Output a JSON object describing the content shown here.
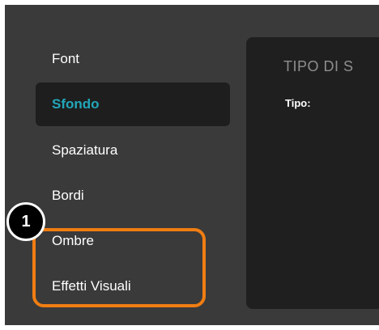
{
  "sidebar": {
    "items": [
      {
        "label": "Font"
      },
      {
        "label": "Sfondo",
        "active": true
      },
      {
        "label": "Spaziatura"
      },
      {
        "label": "Bordi"
      },
      {
        "label": "Ombre"
      },
      {
        "label": "Effetti Visuali"
      }
    ]
  },
  "panel": {
    "title": "TIPO DI S",
    "field_label": "Tipo:"
  },
  "annotation": {
    "badge": "1"
  },
  "colors": {
    "background": "#3a3a3a",
    "active_item_bg": "#1e1e1e",
    "active_item_text": "#22a6b8",
    "highlight": "#f07d12",
    "panel_bg": "#1f1f1f"
  }
}
